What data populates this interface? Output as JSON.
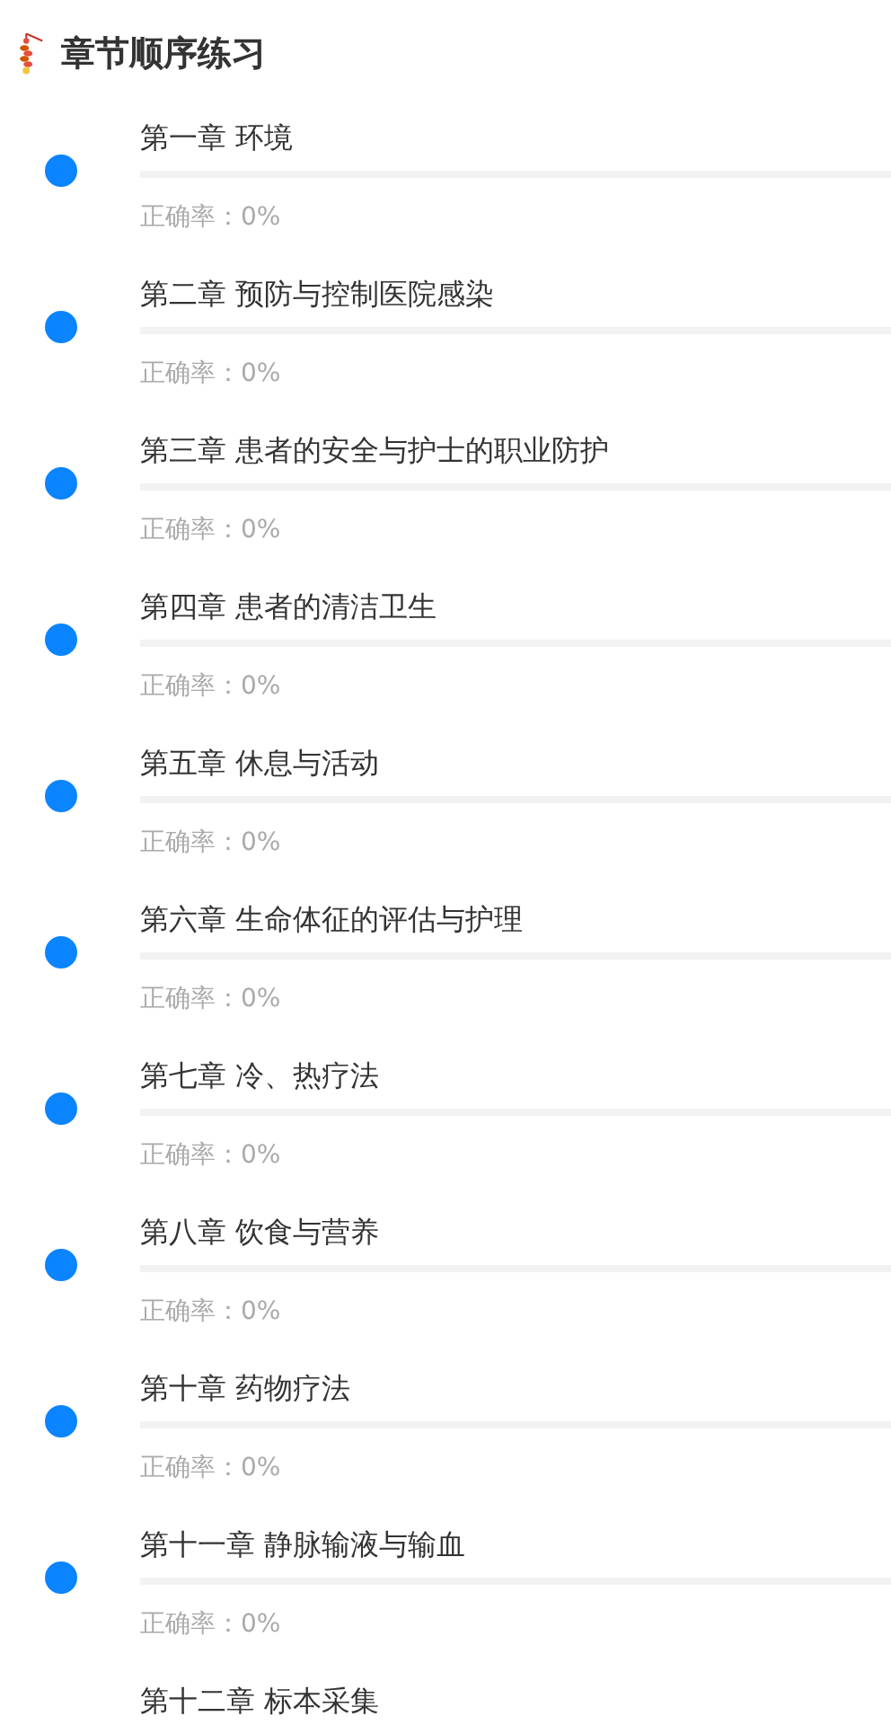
{
  "header": {
    "title": "章节顺序练习"
  },
  "chapters": [
    {
      "title": "第一章 环境",
      "level": 0,
      "accuracy": "正确率：0%"
    },
    {
      "title": "第二章 预防与控制医院感染",
      "level": 0,
      "accuracy": "正确率：0%"
    },
    {
      "title": "第三章 患者的安全与护士的职业防护",
      "level": 0,
      "accuracy": "正确率：0%"
    },
    {
      "title": "第四章 患者的清洁卫生",
      "level": 0,
      "accuracy": "正确率：0%"
    },
    {
      "title": "第五章 休息与活动",
      "level": 0,
      "accuracy": "正确率：0%"
    },
    {
      "title": "第六章 生命体征的评估与护理",
      "level": 0,
      "accuracy": "正确率：0%"
    },
    {
      "title": "第七章 冷、热疗法",
      "level": 0,
      "accuracy": "正确率：0%"
    },
    {
      "title": "第八章 饮食与营养",
      "level": 0,
      "accuracy": "正确率：0%"
    },
    {
      "title": "第十章 药物疗法",
      "level": 0,
      "accuracy": "正确率：0%"
    },
    {
      "title": "第十一章 静脉输液与输血",
      "level": 0,
      "accuracy": "正确率：0%"
    },
    {
      "title": "第十二章 标本采集"
    }
  ]
}
